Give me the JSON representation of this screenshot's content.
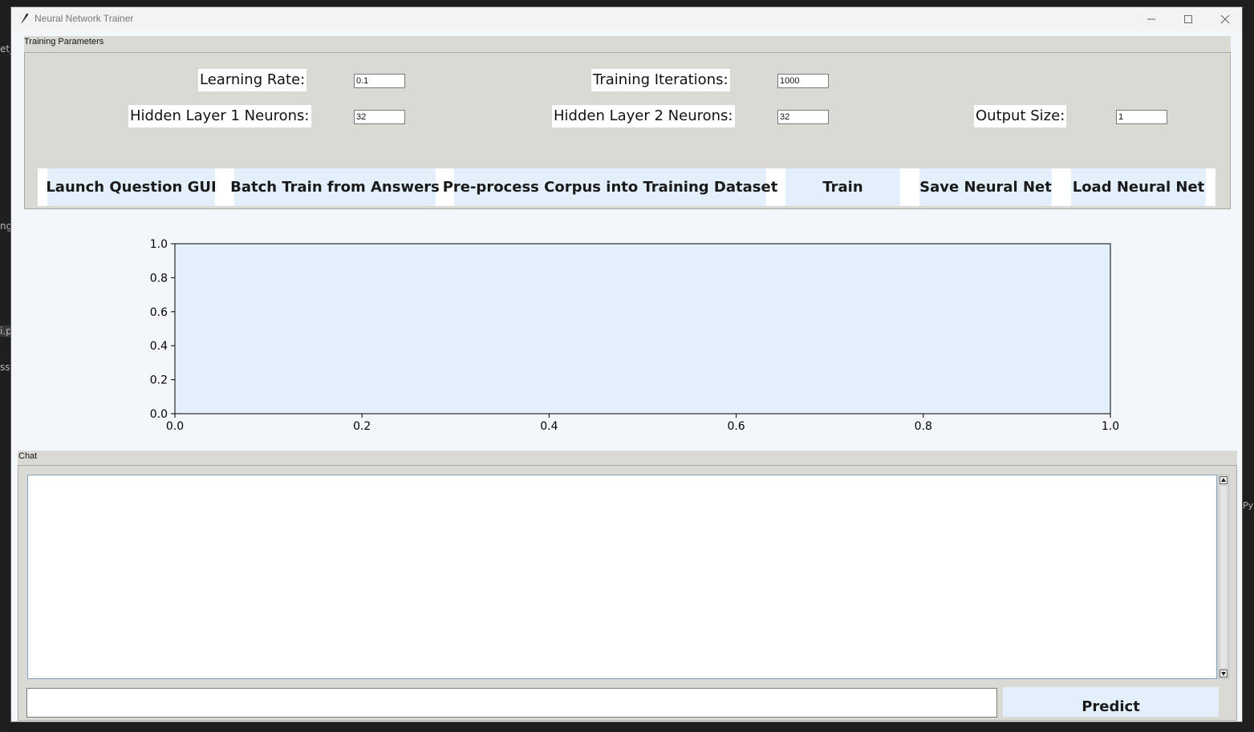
{
  "window": {
    "title": "Neural Network Trainer",
    "controls": {
      "minimize": "minimize-icon",
      "maximize": "maximize-icon",
      "close": "close-icon"
    }
  },
  "background_fragments": [
    "et_",
    "ng",
    "i.p",
    "ssc",
    "Py"
  ],
  "training_parameters": {
    "frame_label": "Training Parameters",
    "fields": {
      "learning_rate": {
        "label": "Learning Rate:",
        "value": "0.1"
      },
      "training_iterations": {
        "label": "Training Iterations:",
        "value": "1000"
      },
      "hidden1": {
        "label": "Hidden Layer 1 Neurons:",
        "value": "32"
      },
      "hidden2": {
        "label": "Hidden Layer 2 Neurons:",
        "value": "32"
      },
      "output_size": {
        "label": "Output Size:",
        "value": "1"
      }
    },
    "buttons": {
      "launch_question_gui": "Launch Question GUI",
      "batch_train": "Batch Train from Answers",
      "preprocess": "Pre-process Corpus into Training Dataset",
      "train": "Train",
      "save": "Save Neural Net",
      "load": "Load Neural Net"
    }
  },
  "chart_data": {
    "type": "line",
    "series": [],
    "x_ticks": [
      "0.0",
      "0.2",
      "0.4",
      "0.6",
      "0.8",
      "1.0"
    ],
    "y_ticks": [
      "0.0",
      "0.2",
      "0.4",
      "0.6",
      "0.8",
      "1.0"
    ],
    "xlim": [
      0,
      1
    ],
    "ylim": [
      0,
      1
    ],
    "plot_background": "#e3f0fb",
    "grid": false
  },
  "chat": {
    "frame_label": "Chat",
    "log_text": "",
    "input_value": "",
    "predict_label": "Predict"
  },
  "colors": {
    "button_bg": "#e3f0fb",
    "frame_bg": "#dad9d4",
    "client_bg": "#f3f6fa"
  }
}
